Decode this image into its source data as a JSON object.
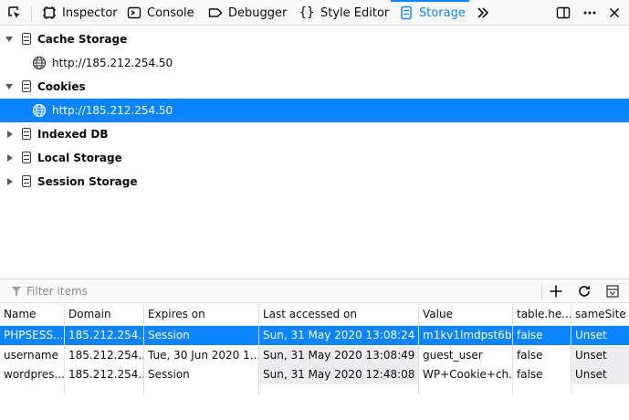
{
  "toolbar": {
    "tabs": [
      {
        "label": "Inspector",
        "icon": "inspector-icon"
      },
      {
        "label": "Console",
        "icon": "console-icon"
      },
      {
        "label": "Debugger",
        "icon": "debugger-icon"
      },
      {
        "label": "Style Editor",
        "icon": "style-editor-icon"
      },
      {
        "label": "Storage",
        "icon": "storage-icon",
        "selected": true
      }
    ],
    "overflow_icon": "chevron-double-right-icon",
    "dock_icon": "dock-side-icon",
    "menu_icon": "more-dots-icon"
  },
  "tree": {
    "items": [
      {
        "label": "Cache Storage",
        "expanded": true,
        "icon": "storage-icon"
      },
      {
        "label": "http://185.212.254.50",
        "icon": "globe-icon"
      },
      {
        "label": "Cookies",
        "expanded": true,
        "icon": "storage-icon"
      },
      {
        "label": "http://185.212.254.50",
        "icon": "globe-icon",
        "selected": true
      },
      {
        "label": "Indexed DB",
        "expanded": false,
        "icon": "storage-icon"
      },
      {
        "label": "Local Storage",
        "expanded": false,
        "icon": "storage-icon"
      },
      {
        "label": "Session Storage",
        "expanded": false,
        "icon": "storage-icon"
      }
    ]
  },
  "filter": {
    "placeholder": "Filter items"
  },
  "actions": {
    "add_icon": "plus-icon",
    "refresh_icon": "refresh-icon",
    "sidebar_icon": "sidebar-toggle-icon"
  },
  "table": {
    "columns": [
      "Name",
      "Domain",
      "Expires on",
      "Last accessed on",
      "Value",
      "table.he...",
      "sameSite"
    ],
    "rows": [
      [
        "PHPSESS...",
        "185.212.254....",
        "Session",
        "Sun, 31 May 2020 13:08:24 G...",
        "m1kv1lmdpst6b...",
        "false",
        "Unset"
      ],
      [
        "username",
        "185.212.254....",
        "Tue, 30 Jun 2020 1...",
        "Sun, 31 May 2020 13:08:49 ...",
        "guest_user",
        "false",
        "Unset"
      ],
      [
        "wordpres...",
        "185.212.254....",
        "Session",
        "Sun, 31 May 2020 12:48:08 G...",
        "WP+Cookie+ch...",
        "false",
        "Unset"
      ]
    ]
  },
  "colors": {
    "accent": "#0a84ff"
  }
}
